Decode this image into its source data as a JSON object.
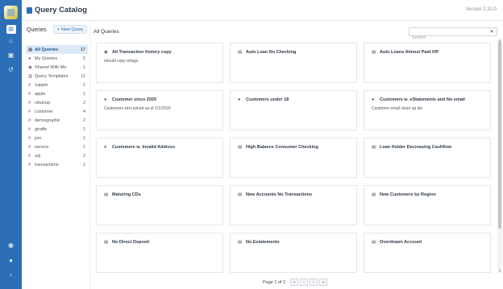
{
  "header": {
    "title": "Query Catalog",
    "version": "Version 2.32.0"
  },
  "rail": {
    "icons": [
      "app-logo",
      "catalog-icon",
      "home-icon",
      "notebook-icon",
      "history-icon",
      "bell-icon",
      "user-icon",
      "expand-icon"
    ]
  },
  "sidebar": {
    "title": "Queries",
    "new_button": "New Query",
    "items": [
      {
        "icon": "list",
        "label": "All Queries",
        "count": "17"
      },
      {
        "icon": "user",
        "label": "My Queries",
        "count": "5"
      },
      {
        "icon": "users",
        "label": "Shared With Me",
        "count": "1"
      },
      {
        "icon": "template",
        "label": "Query Templates",
        "count": "11"
      },
      {
        "icon": "hash",
        "label": "1apple",
        "count": "1"
      },
      {
        "icon": "hash",
        "label": "apple",
        "count": "1"
      },
      {
        "icon": "hash",
        "label": "cleanup",
        "count": "2"
      },
      {
        "icon": "hash",
        "label": "customer",
        "count": "4"
      },
      {
        "icon": "hash",
        "label": "demographic",
        "count": "2"
      },
      {
        "icon": "hash",
        "label": "giraffe",
        "count": "1"
      },
      {
        "icon": "hash",
        "label": "join",
        "count": "1"
      },
      {
        "icon": "hash",
        "label": "service",
        "count": "1"
      },
      {
        "icon": "hash",
        "label": "sql",
        "count": "2"
      },
      {
        "icon": "hash",
        "label": "transactions",
        "count": "1"
      }
    ]
  },
  "main": {
    "breadcrumb": "All Queries",
    "search_placeholder": "Search",
    "cards": [
      {
        "icon": "shared",
        "title": "All Transaction history copy",
        "desc": "should copy w/tags"
      },
      {
        "icon": "table",
        "title": "Auto Loan No Checking",
        "desc": ""
      },
      {
        "icon": "table",
        "title": "Auto Loans Almost Paid Off",
        "desc": ""
      },
      {
        "icon": "user",
        "title": "Customer since 2020",
        "desc": "Customers who joined as of 1/1/2020"
      },
      {
        "icon": "user",
        "title": "Customers under 18",
        "desc": ""
      },
      {
        "icon": "user",
        "title": "Customers w. eStatements and No email",
        "desc": "Customer email clean up list"
      },
      {
        "icon": "user",
        "title": "Customers w. Invalid Address",
        "desc": ""
      },
      {
        "icon": "table",
        "title": "High Balance Consumer Checking",
        "desc": ""
      },
      {
        "icon": "table",
        "title": "Loan Holder Decreasing Cashflow",
        "desc": ""
      },
      {
        "icon": "table",
        "title": "Maturing CDs",
        "desc": ""
      },
      {
        "icon": "table",
        "title": "New Accounts No Transactions",
        "desc": ""
      },
      {
        "icon": "table",
        "title": "New Customers by Region",
        "desc": ""
      },
      {
        "icon": "table",
        "title": "No Direct Deposit",
        "desc": ""
      },
      {
        "icon": "table",
        "title": "No Estatements",
        "desc": ""
      },
      {
        "icon": "table",
        "title": "Overdrawn Account",
        "desc": ""
      }
    ],
    "pagination": {
      "text": "Page 1 of 2",
      "first": "«",
      "prev": "‹",
      "next": "›",
      "last": "»"
    }
  },
  "colors": {
    "rail": "#2c6fb7",
    "selected": "#dce9f7",
    "accent": "#2c6fb7"
  }
}
